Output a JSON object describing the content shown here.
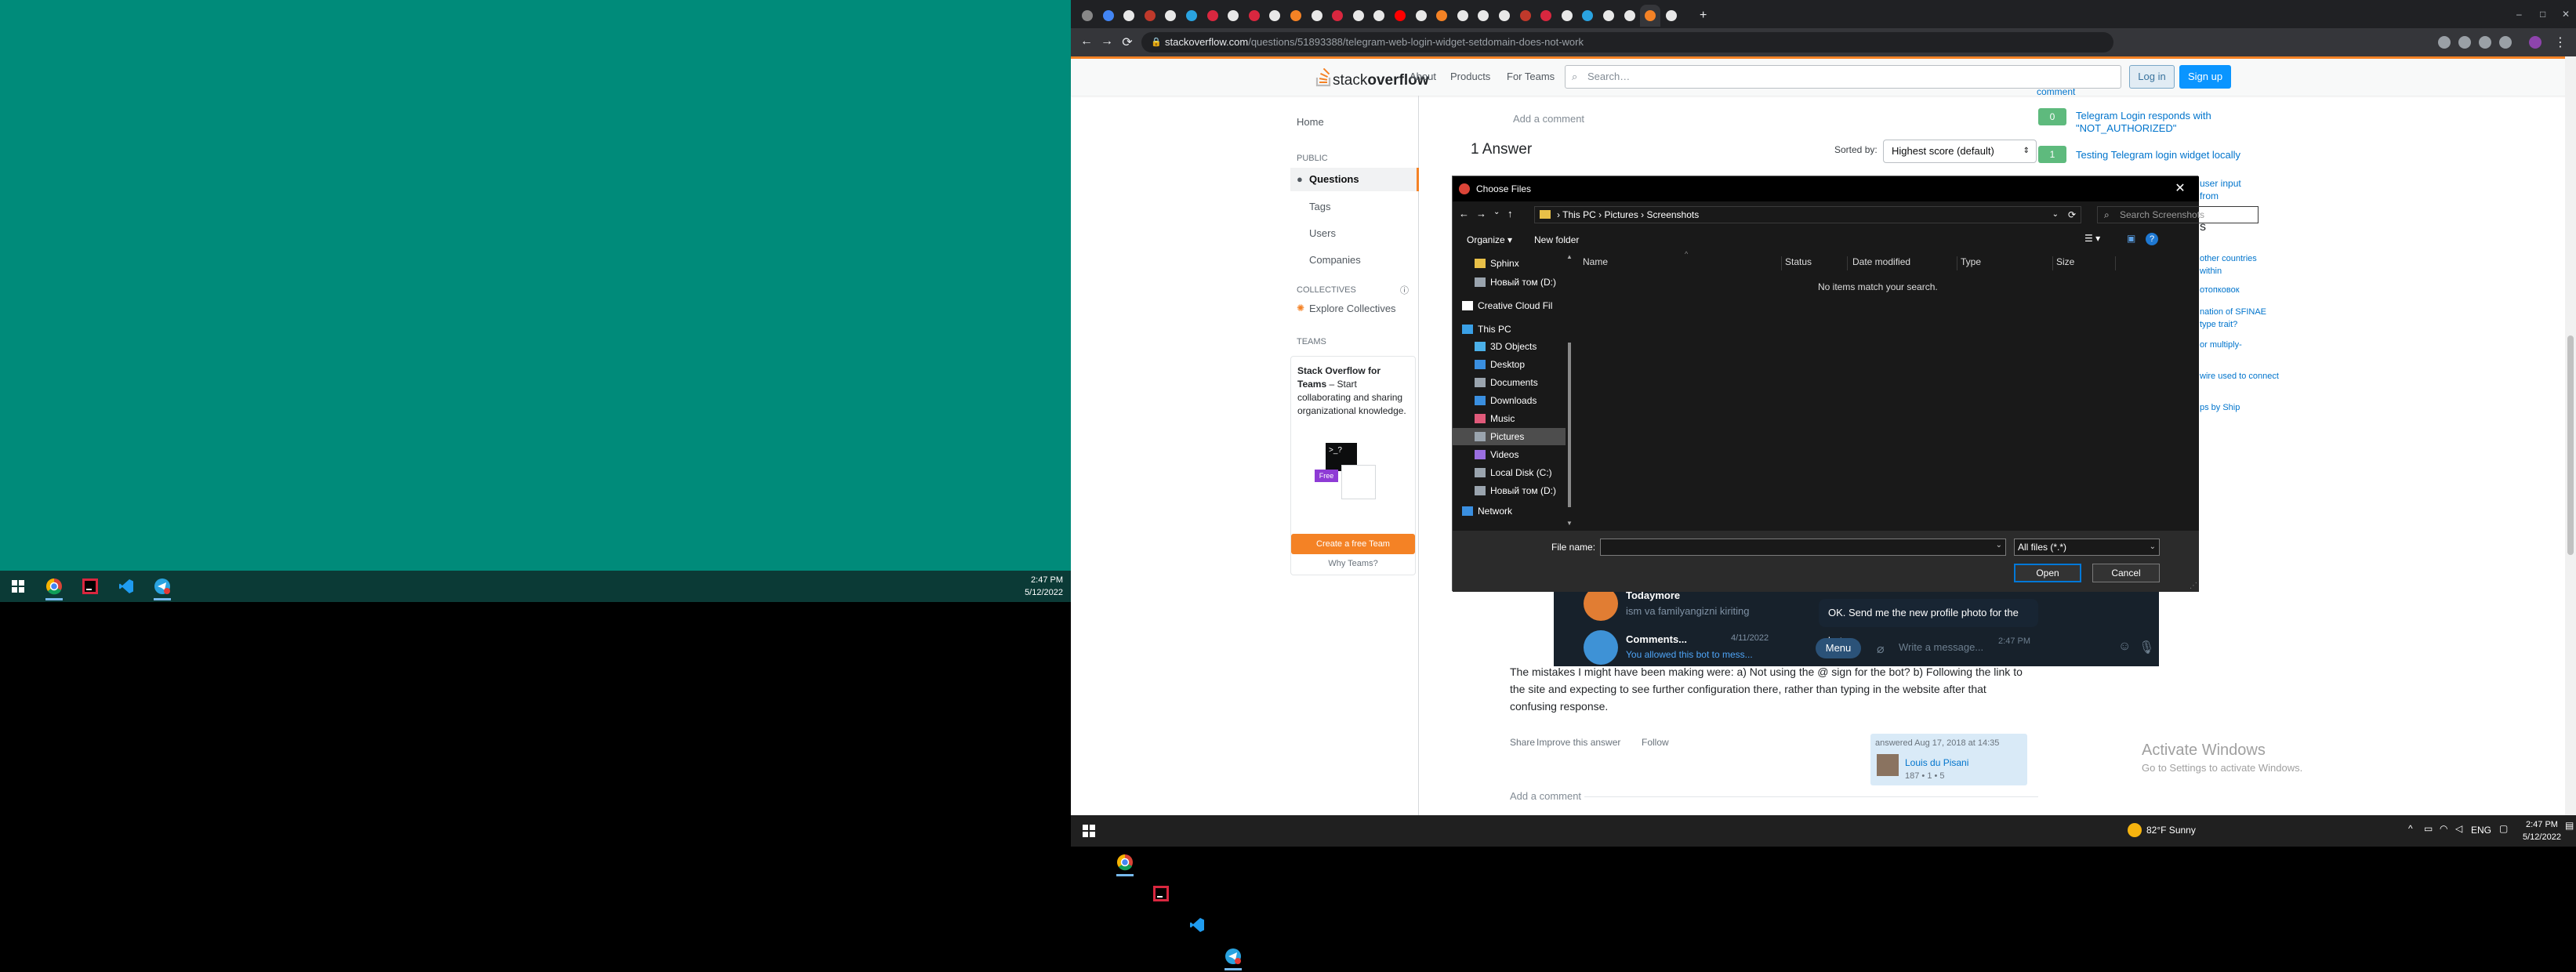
{
  "left_taskbar": {
    "time": "2:47 PM",
    "date": "5/12/2022"
  },
  "browser": {
    "url_host": "stackoverflow.com",
    "url_path": "/questions/51893388/telegram-web-login-widget-setdomain-does-not-work",
    "tabs": [
      "Jb",
      "[E",
      "Bc",
      "tel",
      "Th",
      "Te",
      "Jb",
      "ht",
      "Jb",
      "re",
      "ja",
      "re",
      "Jb",
      "ht",
      "hi",
      "(1",
      "uc",
      "St",
      "Ur",
      "Cc",
      "re",
      "re",
      "Jb",
      "Bc",
      "Te",
      "pl",
      "\"c",
      "au",
      "wi"
    ]
  },
  "so": {
    "logo_light": "stack",
    "logo_bold": "overflow",
    "nav": [
      "About",
      "Products",
      "For Teams"
    ],
    "search_placeholder": "Search…",
    "login": "Log in",
    "signup": "Sign up",
    "sidebar": {
      "home": "Home",
      "public": "PUBLIC",
      "questions": "Questions",
      "tags": "Tags",
      "users": "Users",
      "companies": "Companies",
      "collectives": "COLLECTIVES",
      "explore_collectives": "Explore Collectives",
      "teams": "TEAMS",
      "teams_title": "Stack Overflow for Teams",
      "teams_desc": "– Start collaborating and sharing organizational knowledge.",
      "free_badge": "Free",
      "create_team": "Create a free Team",
      "why_teams": "Why Teams?"
    },
    "add_comment": "Add a comment",
    "answers_heading": "1 Answer",
    "sorted_by": "Sorted by:",
    "sort_value": "Highest score (default)",
    "answer_text": "The mistakes I might have been making were: a) Not using the @ sign for the bot? b) Following the link to the site and expecting to see further configuration there, rather than typing in the website after that confusing response.",
    "answer_actions": [
      "Share",
      "Improve this answer",
      "Follow"
    ],
    "answered": "answered Aug 17, 2018 at 14:35",
    "author": "Louis du Pisani",
    "author_rep": "187 • 1 • 5",
    "linked": [
      {
        "score": "0",
        "title": "Telegram Login responds with \"NOT_AUTHORIZED\""
      },
      {
        "score": "1",
        "title": "Testing Telegram login widget locally"
      }
    ],
    "linked_fragments": [
      "user input from",
      "s",
      "other countries within",
      "отопковок",
      "nation of SFINAE",
      "type trait?",
      "or multiply-",
      "wire used to connect",
      "ps by Ship",
      "comment"
    ]
  },
  "telegram": {
    "row1_name": "Todaymore",
    "row1_msg": "ism va familyangizni kiriting",
    "row2_name": "Comments...",
    "row2_date": "4/11/2022",
    "row2_msg": "You allowed this bot to mess...",
    "bubble": "OK. Send me the new profile photo for the bot.",
    "bubble_time": "2:47 PM",
    "menu": "Menu",
    "input_placeholder": "Write a message..."
  },
  "dialog": {
    "title": "Choose Files",
    "breadcrumb": [
      "This PC",
      "Pictures",
      "Screenshots"
    ],
    "search_placeholder": "Search Screenshots",
    "organize": "Organize ▾",
    "new_folder": "New folder",
    "nav": [
      {
        "label": "Sphinx",
        "type": "folder"
      },
      {
        "label": "Новый том (D:)",
        "type": "drive"
      },
      {
        "label": "Creative Cloud Fil",
        "type": "cc"
      },
      {
        "label": "This PC",
        "type": "pc"
      },
      {
        "label": "3D Objects",
        "type": "obj"
      },
      {
        "label": "Desktop",
        "type": "desk"
      },
      {
        "label": "Documents",
        "type": "docs"
      },
      {
        "label": "Downloads",
        "type": "dl"
      },
      {
        "label": "Music",
        "type": "music"
      },
      {
        "label": "Pictures",
        "type": "pics"
      },
      {
        "label": "Videos",
        "type": "vid"
      },
      {
        "label": "Local Disk (C:)",
        "type": "drive"
      },
      {
        "label": "Новый том (D:)",
        "type": "drive"
      },
      {
        "label": "Network",
        "type": "net"
      }
    ],
    "columns": [
      "Name",
      "Status",
      "Date modified",
      "Type",
      "Size"
    ],
    "empty_message": "No items match your search.",
    "file_name_label": "File name:",
    "file_name_value": "",
    "filter": "All files (*.*)",
    "open": "Open",
    "cancel": "Cancel"
  },
  "right_taskbar": {
    "weather": "82°F  Sunny",
    "lang": "ENG",
    "time": "2:47 PM",
    "date": "5/12/2022"
  },
  "watermark": {
    "line1": "Activate Windows",
    "line2": "Go to Settings to activate Windows."
  },
  "colors": {
    "desktop_left": "#008b7a",
    "so_orange": "#f48225",
    "so_blue": "#0a95ff",
    "dialog_bg": "#191919",
    "telegram_bg": "#17212b"
  }
}
